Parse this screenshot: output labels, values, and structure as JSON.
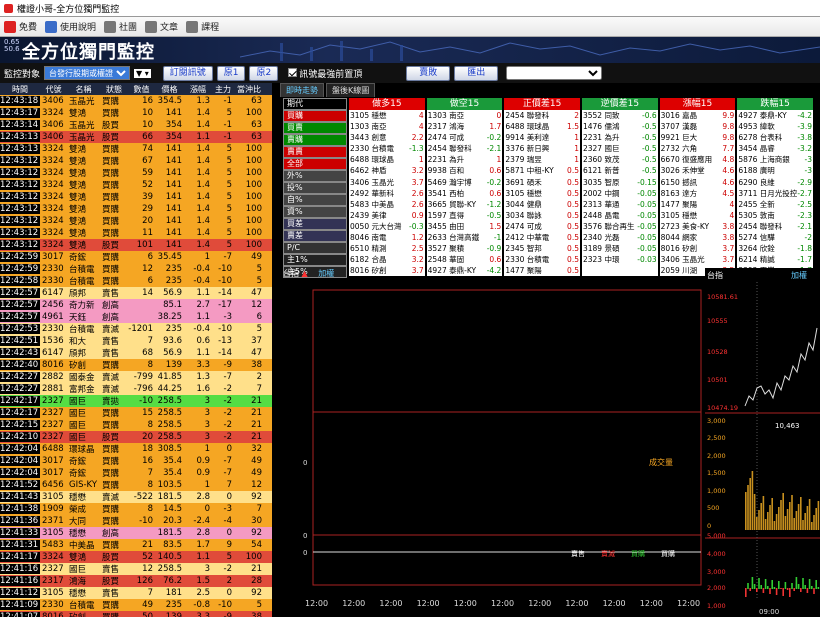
{
  "window": {
    "title": "權證小哥-全方位獨門監控"
  },
  "toolbar": {
    "items": [
      {
        "label": "免費",
        "icon": "free-icon",
        "color": "#d22"
      },
      {
        "label": "使用說明",
        "icon": "help-icon",
        "color": "#3a6cc8"
      },
      {
        "label": "社團",
        "icon": "group-icon",
        "color": "#777"
      },
      {
        "label": "文章",
        "icon": "article-icon",
        "color": "#777"
      },
      {
        "label": "課程",
        "icon": "course-icon",
        "color": "#777"
      }
    ]
  },
  "banner": {
    "sub1": "0.65",
    "sub2": "50.6",
    "title": "全方位獨門監控"
  },
  "controls": {
    "monitor_label": "監控對象",
    "monitor_value": "台發行股期或權證標的",
    "subscribe": "訂閱訊號",
    "group1": "原1",
    "group2": "原2",
    "signal_label": "訊號最強前置頂",
    "buy": "賣敗",
    "export": "匯出"
  },
  "left_table": {
    "headers": [
      "時間",
      "代號",
      "名稱",
      "狀態",
      "數值",
      "價格",
      "漲幅",
      "主力",
      "當沖比"
    ],
    "rows": [
      [
        "12:43:18",
        "3406",
        "玉晶光",
        "買購",
        "16",
        "354.5",
        "1.3",
        "-1",
        "63",
        "#f5a623"
      ],
      [
        "12:43:17",
        "3324",
        "雙鴻",
        "買購",
        "10",
        "141",
        "1.4",
        "5",
        "100",
        "#f5a623"
      ],
      [
        "12:43:14",
        "3406",
        "玉晶光",
        "股買",
        "10",
        "354",
        "1.4",
        "-1",
        "63",
        "#f5a623"
      ],
      [
        "12:43:13",
        "3406",
        "玉晶光",
        "股買",
        "66",
        "354",
        "1.1",
        "-1",
        "63",
        "#e04b3a"
      ],
      [
        "12:43:13",
        "3324",
        "雙鴻",
        "買購",
        "74",
        "141",
        "1.4",
        "5",
        "100",
        "#f5a623"
      ],
      [
        "12:43:12",
        "3324",
        "雙鴻",
        "買購",
        "67",
        "141",
        "1.4",
        "5",
        "100",
        "#f5a623"
      ],
      [
        "12:43:12",
        "3324",
        "雙鴻",
        "買購",
        "59",
        "141",
        "1.4",
        "5",
        "100",
        "#f5a623"
      ],
      [
        "12:43:12",
        "3324",
        "雙鴻",
        "買購",
        "52",
        "141",
        "1.4",
        "5",
        "100",
        "#f5a623"
      ],
      [
        "12:43:12",
        "3324",
        "雙鴻",
        "買購",
        "39",
        "141",
        "1.4",
        "5",
        "100",
        "#f5a623"
      ],
      [
        "12:43:12",
        "3324",
        "雙鴻",
        "買購",
        "29",
        "141",
        "1.4",
        "5",
        "100",
        "#f5a623"
      ],
      [
        "12:43:12",
        "3324",
        "雙鴻",
        "買購",
        "20",
        "141",
        "1.4",
        "5",
        "100",
        "#f5a623"
      ],
      [
        "12:43:12",
        "3324",
        "雙鴻",
        "買購",
        "11",
        "141",
        "1.4",
        "5",
        "100",
        "#f5a623"
      ],
      [
        "12:43:12",
        "3324",
        "雙鴻",
        "股買",
        "101",
        "141",
        "1.4",
        "5",
        "100",
        "#e04b3a"
      ],
      [
        "12:42:59",
        "3017",
        "奇鋐",
        "買購",
        "6",
        "35.45",
        "1",
        "-7",
        "49",
        "#f5a623"
      ],
      [
        "12:42:59",
        "2330",
        "台積電",
        "買購",
        "12",
        "235",
        "-0.4",
        "-10",
        "5",
        "#f5a623"
      ],
      [
        "12:42:58",
        "2330",
        "台積電",
        "買購",
        "6",
        "235",
        "-0.4",
        "-10",
        "5",
        "#f5a623"
      ],
      [
        "12:42:57",
        "6147",
        "頎邦",
        "賣售",
        "14",
        "56.9",
        "1.1",
        "-14",
        "47",
        "#ffe08a"
      ],
      [
        "12:42:57",
        "2456",
        "奇力新",
        "創高",
        "",
        "85.1",
        "2.7",
        "-17",
        "12",
        "#f49ac2"
      ],
      [
        "12:42:57",
        "4961",
        "天鈺",
        "創高",
        "",
        "38.25",
        "1.1",
        "-3",
        "6",
        "#f49ac2"
      ],
      [
        "12:42:53",
        "2330",
        "台積電",
        "賣滅",
        "-1201",
        "235",
        "-0.4",
        "-10",
        "5",
        "#ffe08a"
      ],
      [
        "12:42:51",
        "1536",
        "和大",
        "賣售",
        "7",
        "93.6",
        "0.6",
        "-13",
        "37",
        "#ffe08a"
      ],
      [
        "12:42:43",
        "6147",
        "頎邦",
        "賣售",
        "68",
        "56.9",
        "1.1",
        "-14",
        "47",
        "#ffe08a"
      ],
      [
        "12:42:40",
        "8016",
        "矽創",
        "買購",
        "8",
        "139",
        "3.3",
        "-9",
        "38",
        "#f5a623"
      ],
      [
        "12:42:27",
        "2882",
        "國泰金",
        "賣滅",
        "-799",
        "41.85",
        "1.3",
        "-7",
        "2",
        "#ffe08a"
      ],
      [
        "12:42:27",
        "2881",
        "富邦金",
        "賣滅",
        "-796",
        "44.25",
        "1.6",
        "-2",
        "7",
        "#ffe08a"
      ],
      [
        "12:42:17",
        "2327",
        "國巨",
        "賣拋",
        "-10",
        "258.5",
        "3",
        "-2",
        "21",
        "#55dd44"
      ],
      [
        "12:42:17",
        "2327",
        "國巨",
        "買購",
        "15",
        "258.5",
        "3",
        "-2",
        "21",
        "#f5a623"
      ],
      [
        "12:42:15",
        "2327",
        "國巨",
        "買購",
        "8",
        "258.5",
        "3",
        "-2",
        "21",
        "#f5a623"
      ],
      [
        "12:42:10",
        "2327",
        "國巨",
        "股買",
        "20",
        "258.5",
        "3",
        "-2",
        "21",
        "#e04b3a"
      ],
      [
        "12:42:04",
        "6488",
        "環球晶",
        "買購",
        "18",
        "308.5",
        "1",
        "0",
        "32",
        "#f5a623"
      ],
      [
        "12:42:04",
        "3017",
        "奇鋐",
        "買購",
        "16",
        "35.4",
        "0.9",
        "-7",
        "49",
        "#f5a623"
      ],
      [
        "12:42:04",
        "3017",
        "奇鋐",
        "買購",
        "7",
        "35.4",
        "0.9",
        "-7",
        "49",
        "#f5a623"
      ],
      [
        "12:41:52",
        "6456",
        "GIS-KY",
        "買購",
        "8",
        "103.5",
        "1",
        "7",
        "12",
        "#f5a623"
      ],
      [
        "12:41:43",
        "3105",
        "穩懋",
        "賣滅",
        "-522",
        "181.5",
        "2.8",
        "0",
        "92",
        "#ffe08a"
      ],
      [
        "12:41:38",
        "1909",
        "榮成",
        "買購",
        "8",
        "14.5",
        "0",
        "-3",
        "7",
        "#f5a623"
      ],
      [
        "12:41:36",
        "2371",
        "大同",
        "買購",
        "-10",
        "20.3",
        "-2.4",
        "-4",
        "30",
        "#f5a623"
      ],
      [
        "12:41:33",
        "3105",
        "穩懋",
        "創高",
        "",
        "181.5",
        "2.8",
        "0",
        "92",
        "#f49ac2"
      ],
      [
        "12:41:31",
        "5483",
        "中美晶",
        "買購",
        "21",
        "83.5",
        "1.7",
        "9",
        "54",
        "#f5a623"
      ],
      [
        "12:41:17",
        "3324",
        "雙鴻",
        "股買",
        "52",
        "140.5",
        "1.1",
        "5",
        "100",
        "#e04b3a"
      ],
      [
        "12:41:16",
        "2327",
        "國巨",
        "賣售",
        "12",
        "258.5",
        "3",
        "-2",
        "21",
        "#ffe08a"
      ],
      [
        "12:41:16",
        "2317",
        "鴻海",
        "股買",
        "126",
        "76.2",
        "1.5",
        "2",
        "28",
        "#e04b3a"
      ],
      [
        "12:41:12",
        "3105",
        "穩懋",
        "賣售",
        "7",
        "181",
        "2.5",
        "0",
        "92",
        "#ffe08a"
      ],
      [
        "12:41:09",
        "2330",
        "台積電",
        "買購",
        "49",
        "235",
        "-0.8",
        "-10",
        "5",
        "#f5a623"
      ],
      [
        "12:41:07",
        "8016",
        "矽創",
        "買購",
        "50",
        "139",
        "3.3",
        "-9",
        "38",
        "#e04b3a"
      ]
    ]
  },
  "tabs": [
    "即時走勢",
    "盤後K線圖"
  ],
  "side_buttons": [
    {
      "label": "期代",
      "bg": "#000",
      "fg": "#fff"
    },
    {
      "label": "買購",
      "bg": "#c00",
      "fg": "#fff"
    },
    {
      "label": "買賣",
      "bg": "#080",
      "fg": "#fff"
    },
    {
      "label": "賣購",
      "bg": "#080",
      "fg": "#fff"
    },
    {
      "label": "賣賣",
      "bg": "#c00",
      "fg": "#fff"
    },
    {
      "label": "全部",
      "bg": "#c00",
      "fg": "#fff"
    },
    {
      "label": "外%",
      "bg": "#444",
      "fg": "#fff"
    },
    {
      "label": "投%",
      "bg": "#444",
      "fg": "#fff"
    },
    {
      "label": "自%",
      "bg": "#444",
      "fg": "#fff"
    },
    {
      "label": "資%",
      "bg": "#444",
      "fg": "#fff"
    },
    {
      "label": "買差",
      "bg": "#335",
      "fg": "#fff"
    },
    {
      "label": "賣差",
      "bg": "#335",
      "fg": "#fff"
    },
    {
      "label": "P/C",
      "bg": "#333",
      "fg": "#fff"
    },
    {
      "label": "主1%",
      "bg": "#222",
      "fg": "#fff"
    },
    {
      "label": "主5%",
      "bg": "#222",
      "fg": "#fff"
    }
  ],
  "ranks": [
    {
      "title": "做多15",
      "color": "#d00",
      "rows": [
        [
          "3105 穩懋",
          "4"
        ],
        [
          "1303 南亞",
          "4"
        ],
        [
          "3443 創意",
          "2.2"
        ],
        [
          "2330 台積電",
          "-1.3"
        ],
        [
          "6488 環球晶",
          "1"
        ],
        [
          "6462 神盾",
          "3.2"
        ],
        [
          "3406 玉晶光",
          "3.7"
        ],
        [
          "2492 華新科",
          "2.6"
        ],
        [
          "5483 中美晶",
          "2.6"
        ],
        [
          "2439 美律",
          "0.9"
        ],
        [
          "0050 元大台灣",
          "-0.3"
        ],
        [
          "8046 南電",
          "1.2"
        ],
        [
          "6510 精測",
          "2.5"
        ],
        [
          "6182 合晶",
          "3.2"
        ],
        [
          "8016 矽創",
          "3.7"
        ]
      ]
    },
    {
      "title": "做空15",
      "color": "#1a9a3a",
      "rows": [
        [
          "1303 南亞",
          "0"
        ],
        [
          "2317 鴻海",
          "1.7"
        ],
        [
          "2474 可成",
          "-0.2"
        ],
        [
          "2454 聯發科",
          "-2.1"
        ],
        [
          "2231 為升",
          "1"
        ],
        [
          "9938 百和",
          "0.6"
        ],
        [
          "5469 瀚宇博",
          "-0.2"
        ],
        [
          "3541 西柏",
          "0.6"
        ],
        [
          "3665 貿聯-KY",
          "-1.2"
        ],
        [
          "1597 直得",
          "-0.5"
        ],
        [
          "3455 由田",
          "1.5"
        ],
        [
          "2633 台灣高鐵",
          "-1"
        ],
        [
          "3527 聚積",
          "-0.9"
        ],
        [
          "2548 華固",
          "0.6"
        ],
        [
          "4927 泰鼎-KY",
          "-4.2"
        ]
      ]
    },
    {
      "title": "正價差15",
      "color": "#d00",
      "rows": [
        [
          "2454 聯發科",
          "2"
        ],
        [
          "6488 環球晶",
          "1.5"
        ],
        [
          "9914 美利達",
          "1"
        ],
        [
          "3376 新日興",
          "1"
        ],
        [
          "2379 瑞昱",
          "1"
        ],
        [
          "5871 中租-KY",
          "0.5"
        ],
        [
          "3691 碩禾",
          "0.5"
        ],
        [
          "3105 穩懋",
          "0.5"
        ],
        [
          "3044 健鼎",
          "0.5"
        ],
        [
          "3034 聯詠",
          "0.5"
        ],
        [
          "2474 可成",
          "0.5"
        ],
        [
          "2412 中華電",
          "0.5"
        ],
        [
          "2345 智邦",
          "0.5"
        ],
        [
          "2330 台積電",
          "0.5"
        ],
        [
          "1477 聚陽",
          "0.5"
        ]
      ]
    },
    {
      "title": "逆價差15",
      "color": "#1a9a3a",
      "rows": [
        [
          "3552 同致",
          "-0.6"
        ],
        [
          "1476 儒鴻",
          "-0.5"
        ],
        [
          "2231 為升",
          "-0.5"
        ],
        [
          "2327 國巨",
          "-0.5"
        ],
        [
          "2360 致茂",
          "-0.5"
        ],
        [
          "6121 新普",
          "-0.5"
        ],
        [
          "3035 智原",
          "-0.15"
        ],
        [
          "2002 中鋼",
          "-0.05"
        ],
        [
          "2313 華通",
          "-0.05"
        ],
        [
          "2448 晶電",
          "-0.05"
        ],
        [
          "3576 聯合再生",
          "-0.05"
        ],
        [
          "2340 光磊",
          "-0.05"
        ],
        [
          "3189 景碩",
          "-0.05"
        ],
        [
          "2323 中環",
          "-0.03"
        ],
        [
          "",
          ""
        ]
      ]
    },
    {
      "title": "漲幅15",
      "color": "#d00",
      "rows": [
        [
          "3016 嘉晶",
          "9.9"
        ],
        [
          "3707 漢磊",
          "9.8"
        ],
        [
          "9921 巨大",
          "9.8"
        ],
        [
          "2732 六角",
          "7.7"
        ],
        [
          "6670 復盛應用",
          "4.8"
        ],
        [
          "3026 禾伸堂",
          "4.6"
        ],
        [
          "6150 撼訊",
          "4.6"
        ],
        [
          "8163 達方",
          "4.5"
        ],
        [
          "1477 聚陽",
          "4"
        ],
        [
          "3105 穩懋",
          "4"
        ],
        [
          "2723 美食-KY",
          "3.8"
        ],
        [
          "8044 網家",
          "3.8"
        ],
        [
          "8016 矽創",
          "3.7"
        ],
        [
          "3406 玉晶光",
          "3.7"
        ],
        [
          "2059 川湖",
          "3.5"
        ]
      ]
    },
    {
      "title": "跌幅15",
      "color": "#1a9a3a",
      "rows": [
        [
          "4927 泰鼎-KY",
          "-4.2"
        ],
        [
          "4953 緯軟",
          "-3.9"
        ],
        [
          "6278 台表科",
          "-3.8"
        ],
        [
          "3454 晶睿",
          "-3.2"
        ],
        [
          "5876 上海商銀",
          "-3"
        ],
        [
          "6188 廣明",
          "-3"
        ],
        [
          "6290 良維",
          "-2.9"
        ],
        [
          "3711 日月光投控",
          "-2.7"
        ],
        [
          "2455 全新",
          "-2.5"
        ],
        [
          "5305 敦南",
          "-2.3"
        ],
        [
          "2454 聯發科",
          "-2.1"
        ],
        [
          "5274 信驊",
          "-2"
        ],
        [
          "3264 欣銓",
          "-1.8"
        ],
        [
          "6214 精誠",
          "-1.7"
        ],
        [
          "2392 正崴",
          "-1.7"
        ]
      ]
    }
  ],
  "infobar": {
    "label1": "台指",
    "label2": "加權"
  },
  "chartA": {
    "y_ticks": [
      "0",
      "0",
      "0"
    ],
    "annotation": "成交量",
    "legend": [
      "賣售",
      "賣滅",
      "買購",
      "買購"
    ],
    "x_ticks": [
      "12:00",
      "12:00",
      "12:00",
      "12:00",
      "12:00",
      "12:00",
      "12:00",
      "12:00",
      "12:00",
      "12:00",
      "12:00"
    ]
  },
  "chartB": {
    "header_left": "台指",
    "header_right": "加權",
    "y_ticks": [
      "10581.61",
      "10555",
      "10528",
      "10501",
      "10474.19",
      "3,000",
      "2,500",
      "2,000",
      "1,500",
      "1,000",
      "500",
      "0",
      "5,000",
      "4,000",
      "3,000",
      "2,000",
      "1,000",
      "0",
      "-1,000"
    ],
    "price_label": "10,463",
    "x_tick": "09:00"
  }
}
